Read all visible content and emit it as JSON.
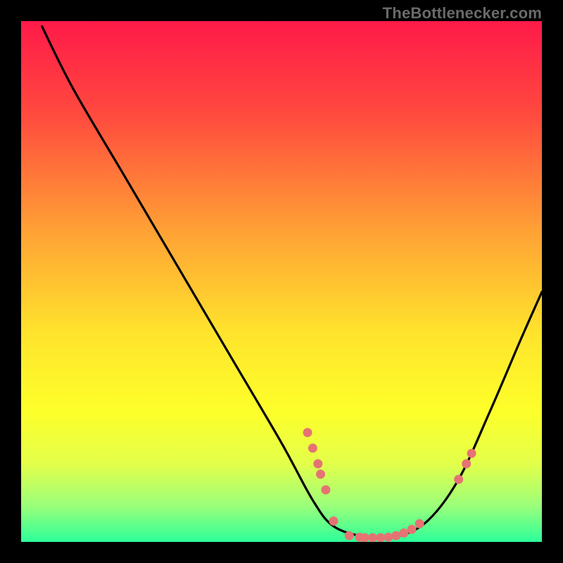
{
  "attribution": "TheBottlenecker.com",
  "chart_data": {
    "type": "line",
    "title": "",
    "xlabel": "",
    "ylabel": "",
    "xlim": [
      0,
      100
    ],
    "ylim": [
      0,
      100
    ],
    "gradient_stops": [
      {
        "offset": 0,
        "color": "#ff1a49"
      },
      {
        "offset": 0.18,
        "color": "#ff4a3e"
      },
      {
        "offset": 0.4,
        "color": "#ffa035"
      },
      {
        "offset": 0.6,
        "color": "#ffe42c"
      },
      {
        "offset": 0.75,
        "color": "#fdff2a"
      },
      {
        "offset": 0.85,
        "color": "#e3ff4a"
      },
      {
        "offset": 0.93,
        "color": "#9cff7a"
      },
      {
        "offset": 1.0,
        "color": "#2cff9a"
      }
    ],
    "curve_points": [
      {
        "x": 4,
        "y": 99
      },
      {
        "x": 10,
        "y": 87
      },
      {
        "x": 20,
        "y": 70
      },
      {
        "x": 30,
        "y": 53
      },
      {
        "x": 40,
        "y": 36
      },
      {
        "x": 50,
        "y": 19
      },
      {
        "x": 56,
        "y": 8
      },
      {
        "x": 60,
        "y": 3
      },
      {
        "x": 66,
        "y": 1
      },
      {
        "x": 72,
        "y": 1
      },
      {
        "x": 78,
        "y": 4
      },
      {
        "x": 84,
        "y": 12
      },
      {
        "x": 90,
        "y": 25
      },
      {
        "x": 96,
        "y": 39
      },
      {
        "x": 100,
        "y": 48
      }
    ],
    "marker_points": [
      {
        "x": 55,
        "y": 21
      },
      {
        "x": 56,
        "y": 18
      },
      {
        "x": 57,
        "y": 15
      },
      {
        "x": 57.5,
        "y": 13
      },
      {
        "x": 58.5,
        "y": 10
      },
      {
        "x": 60,
        "y": 4
      },
      {
        "x": 63,
        "y": 1.2
      },
      {
        "x": 65,
        "y": 0.9
      },
      {
        "x": 66,
        "y": 0.8
      },
      {
        "x": 67.5,
        "y": 0.8
      },
      {
        "x": 69,
        "y": 0.8
      },
      {
        "x": 70.5,
        "y": 0.9
      },
      {
        "x": 72,
        "y": 1.2
      },
      {
        "x": 73.5,
        "y": 1.7
      },
      {
        "x": 75,
        "y": 2.4
      },
      {
        "x": 76.5,
        "y": 3.5
      },
      {
        "x": 84,
        "y": 12
      },
      {
        "x": 85.5,
        "y": 15
      },
      {
        "x": 86.5,
        "y": 17
      }
    ],
    "marker_color": "#e57373",
    "curve_color": "#000000",
    "curve_width": 3.2
  }
}
